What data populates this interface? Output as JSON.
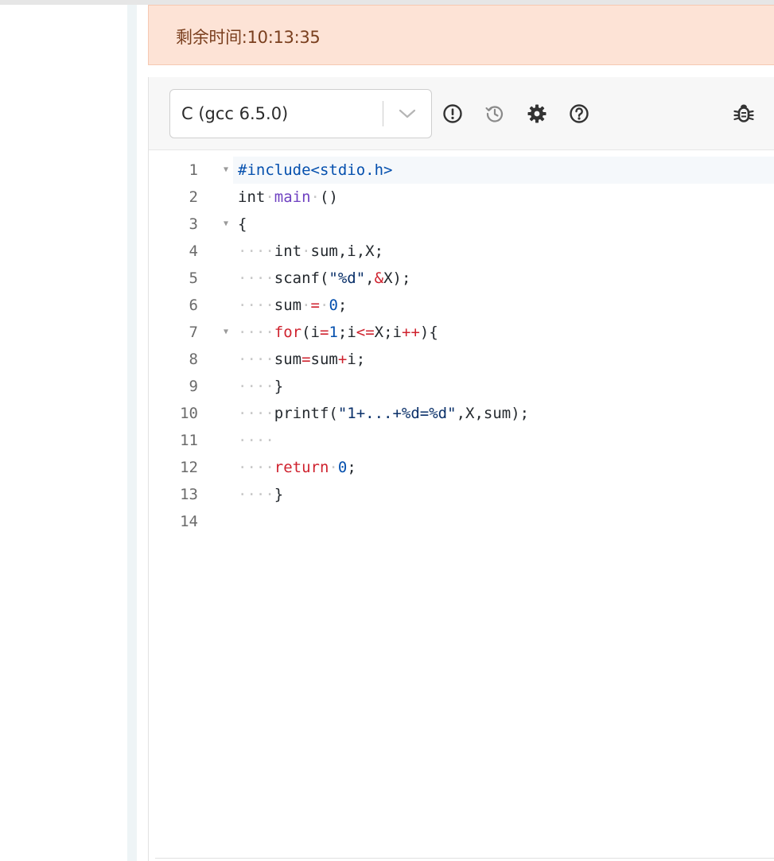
{
  "timer": {
    "label": "剩余时间:10:13:35"
  },
  "toolbar": {
    "language_selected": "C (gcc 6.5.0)",
    "icons": [
      "exclamation-circle-icon",
      "history-icon",
      "gear-icon",
      "question-circle-icon",
      "bug-icon"
    ]
  },
  "editor": {
    "lines": [
      {
        "num": "1",
        "fold": true,
        "active": true,
        "tokens": [
          {
            "t": "#include<stdio.h>",
            "c": "pp"
          }
        ]
      },
      {
        "num": "2",
        "fold": false,
        "tokens": [
          {
            "t": "int",
            "c": "kw"
          },
          {
            "t": "·",
            "c": "dot"
          },
          {
            "t": "main",
            "c": "fn"
          },
          {
            "t": "·",
            "c": "dot"
          },
          {
            "t": "()",
            "c": "kw"
          }
        ]
      },
      {
        "num": "3",
        "fold": true,
        "tokens": [
          {
            "t": "{",
            "c": "kw"
          }
        ]
      },
      {
        "num": "4",
        "fold": false,
        "tokens": [
          {
            "t": "····",
            "c": "dot"
          },
          {
            "t": "int",
            "c": "kw"
          },
          {
            "t": "·",
            "c": "dot"
          },
          {
            "t": "sum,i,X;",
            "c": "kw"
          }
        ]
      },
      {
        "num": "5",
        "fold": false,
        "tokens": [
          {
            "t": "····",
            "c": "dot"
          },
          {
            "t": "scanf(",
            "c": "kw"
          },
          {
            "t": "\"%d\"",
            "c": "str"
          },
          {
            "t": ",",
            "c": "kw"
          },
          {
            "t": "&",
            "c": "op"
          },
          {
            "t": "X);",
            "c": "kw"
          }
        ]
      },
      {
        "num": "6",
        "fold": false,
        "tokens": [
          {
            "t": "····",
            "c": "dot"
          },
          {
            "t": "sum",
            "c": "kw"
          },
          {
            "t": "·",
            "c": "dot"
          },
          {
            "t": "=",
            "c": "op"
          },
          {
            "t": "·",
            "c": "dot"
          },
          {
            "t": "0",
            "c": "num"
          },
          {
            "t": ";",
            "c": "kw"
          }
        ]
      },
      {
        "num": "7",
        "fold": true,
        "tokens": [
          {
            "t": "····",
            "c": "dot"
          },
          {
            "t": "for",
            "c": "ret"
          },
          {
            "t": "(i",
            "c": "kw"
          },
          {
            "t": "=",
            "c": "op"
          },
          {
            "t": "1",
            "c": "num"
          },
          {
            "t": ";i",
            "c": "kw"
          },
          {
            "t": "<=",
            "c": "op"
          },
          {
            "t": "X;i",
            "c": "kw"
          },
          {
            "t": "++",
            "c": "op"
          },
          {
            "t": "){",
            "c": "kw"
          }
        ]
      },
      {
        "num": "8",
        "fold": false,
        "tokens": [
          {
            "t": "····",
            "c": "dot"
          },
          {
            "t": "sum",
            "c": "kw"
          },
          {
            "t": "=",
            "c": "op"
          },
          {
            "t": "sum",
            "c": "kw"
          },
          {
            "t": "+",
            "c": "op"
          },
          {
            "t": "i;",
            "c": "kw"
          }
        ]
      },
      {
        "num": "9",
        "fold": false,
        "tokens": [
          {
            "t": "····",
            "c": "dot"
          },
          {
            "t": "}",
            "c": "kw"
          }
        ]
      },
      {
        "num": "10",
        "fold": false,
        "tokens": [
          {
            "t": "····",
            "c": "dot"
          },
          {
            "t": "printf(",
            "c": "kw"
          },
          {
            "t": "\"1+...+%d=%d\"",
            "c": "str"
          },
          {
            "t": ",X,sum);",
            "c": "kw"
          }
        ]
      },
      {
        "num": "11",
        "fold": false,
        "tokens": [
          {
            "t": "····",
            "c": "dot"
          }
        ]
      },
      {
        "num": "12",
        "fold": false,
        "tokens": [
          {
            "t": "····",
            "c": "dot"
          },
          {
            "t": "return",
            "c": "ret"
          },
          {
            "t": "·",
            "c": "dot"
          },
          {
            "t": "0",
            "c": "num"
          },
          {
            "t": ";",
            "c": "kw"
          }
        ]
      },
      {
        "num": "13",
        "fold": false,
        "tokens": [
          {
            "t": "····",
            "c": "dot"
          },
          {
            "t": "}",
            "c": "kw"
          }
        ]
      },
      {
        "num": "14",
        "fold": false,
        "tokens": []
      }
    ]
  },
  "colors": {
    "timer_bg": "#fde3d6",
    "timer_text": "#7a3f1e",
    "toolbar_bg": "#f7f7f7",
    "keyword_red": "#cf222e",
    "preprocessor_blue": "#0550ae",
    "function_purple": "#6f42c1"
  }
}
